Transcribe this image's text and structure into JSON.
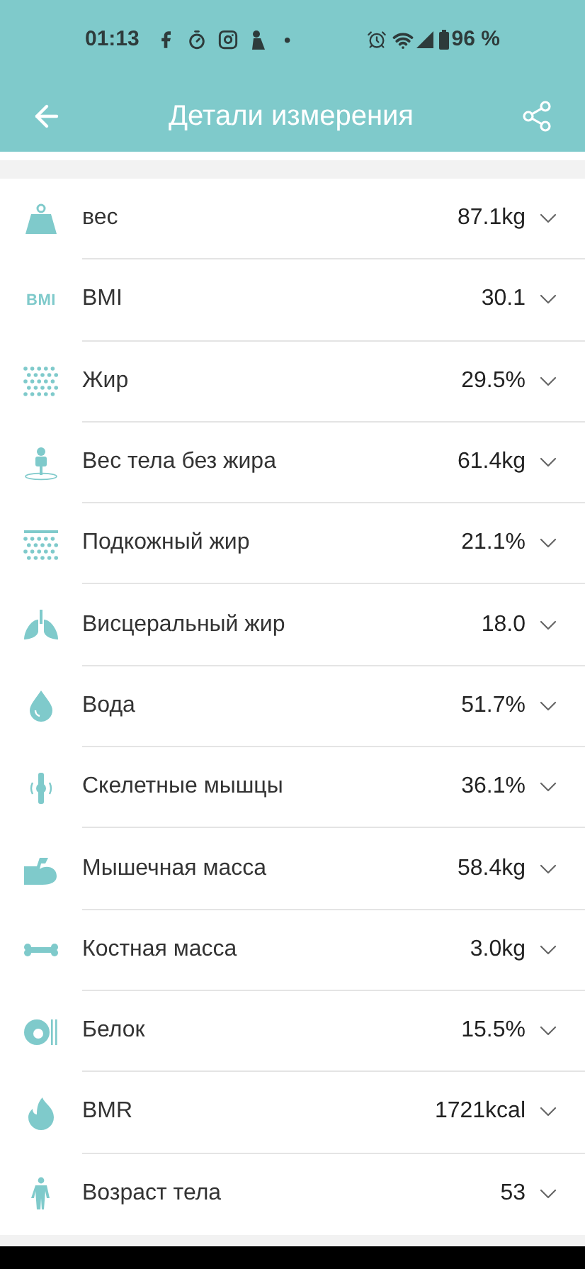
{
  "status_bar": {
    "time": "01:13",
    "dot": "•",
    "battery": "96 %"
  },
  "header": {
    "title": "Детали измерения"
  },
  "rows": [
    {
      "kind": "weight",
      "label": "вес",
      "value": "87.1kg"
    },
    {
      "kind": "bmi",
      "icon_label": "BMI",
      "label": "BMI",
      "value": "30.1"
    },
    {
      "kind": "fat",
      "label": "Жир",
      "value": "29.5%"
    },
    {
      "kind": "lean",
      "label": "Вес тела без жира",
      "value": "61.4kg"
    },
    {
      "kind": "subcutaneous",
      "label": "Подкожный жир",
      "value": "21.1%"
    },
    {
      "kind": "visceral",
      "label": "Висцеральный жир",
      "value": "18.0"
    },
    {
      "kind": "water",
      "label": "Вода",
      "value": "51.7%"
    },
    {
      "kind": "skeletal",
      "label": "Скелетные мышцы",
      "value": "36.1%"
    },
    {
      "kind": "muscle",
      "label": "Мышечная масса",
      "value": "58.4kg"
    },
    {
      "kind": "bone",
      "label": "Костная масса",
      "value": "3.0kg"
    },
    {
      "kind": "protein",
      "label": "Белок",
      "value": "15.5%"
    },
    {
      "kind": "bmr",
      "label": "BMR",
      "value": "1721kcal"
    },
    {
      "kind": "age",
      "label": "Возраст тела",
      "value": "53"
    }
  ]
}
